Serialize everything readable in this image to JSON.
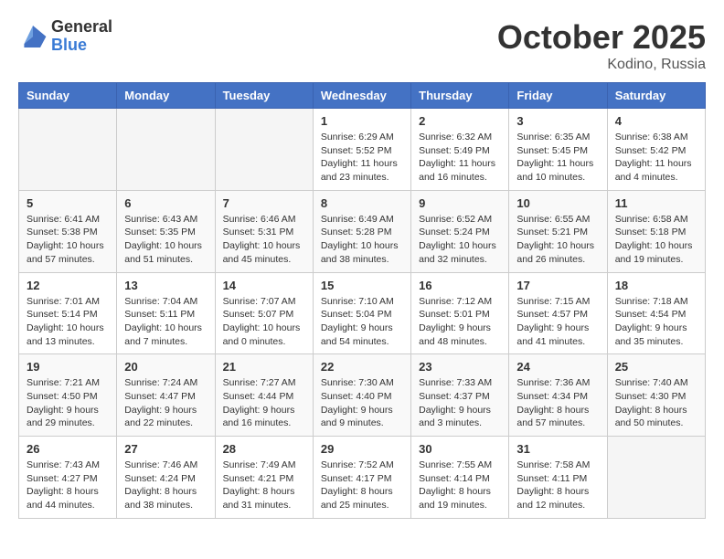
{
  "header": {
    "logo_general": "General",
    "logo_blue": "Blue",
    "month": "October 2025",
    "location": "Kodino, Russia"
  },
  "weekdays": [
    "Sunday",
    "Monday",
    "Tuesday",
    "Wednesday",
    "Thursday",
    "Friday",
    "Saturday"
  ],
  "weeks": [
    [
      {
        "day": "",
        "info": ""
      },
      {
        "day": "",
        "info": ""
      },
      {
        "day": "",
        "info": ""
      },
      {
        "day": "1",
        "info": "Sunrise: 6:29 AM\nSunset: 5:52 PM\nDaylight: 11 hours\nand 23 minutes."
      },
      {
        "day": "2",
        "info": "Sunrise: 6:32 AM\nSunset: 5:49 PM\nDaylight: 11 hours\nand 16 minutes."
      },
      {
        "day": "3",
        "info": "Sunrise: 6:35 AM\nSunset: 5:45 PM\nDaylight: 11 hours\nand 10 minutes."
      },
      {
        "day": "4",
        "info": "Sunrise: 6:38 AM\nSunset: 5:42 PM\nDaylight: 11 hours\nand 4 minutes."
      }
    ],
    [
      {
        "day": "5",
        "info": "Sunrise: 6:41 AM\nSunset: 5:38 PM\nDaylight: 10 hours\nand 57 minutes."
      },
      {
        "day": "6",
        "info": "Sunrise: 6:43 AM\nSunset: 5:35 PM\nDaylight: 10 hours\nand 51 minutes."
      },
      {
        "day": "7",
        "info": "Sunrise: 6:46 AM\nSunset: 5:31 PM\nDaylight: 10 hours\nand 45 minutes."
      },
      {
        "day": "8",
        "info": "Sunrise: 6:49 AM\nSunset: 5:28 PM\nDaylight: 10 hours\nand 38 minutes."
      },
      {
        "day": "9",
        "info": "Sunrise: 6:52 AM\nSunset: 5:24 PM\nDaylight: 10 hours\nand 32 minutes."
      },
      {
        "day": "10",
        "info": "Sunrise: 6:55 AM\nSunset: 5:21 PM\nDaylight: 10 hours\nand 26 minutes."
      },
      {
        "day": "11",
        "info": "Sunrise: 6:58 AM\nSunset: 5:18 PM\nDaylight: 10 hours\nand 19 minutes."
      }
    ],
    [
      {
        "day": "12",
        "info": "Sunrise: 7:01 AM\nSunset: 5:14 PM\nDaylight: 10 hours\nand 13 minutes."
      },
      {
        "day": "13",
        "info": "Sunrise: 7:04 AM\nSunset: 5:11 PM\nDaylight: 10 hours\nand 7 minutes."
      },
      {
        "day": "14",
        "info": "Sunrise: 7:07 AM\nSunset: 5:07 PM\nDaylight: 10 hours\nand 0 minutes."
      },
      {
        "day": "15",
        "info": "Sunrise: 7:10 AM\nSunset: 5:04 PM\nDaylight: 9 hours\nand 54 minutes."
      },
      {
        "day": "16",
        "info": "Sunrise: 7:12 AM\nSunset: 5:01 PM\nDaylight: 9 hours\nand 48 minutes."
      },
      {
        "day": "17",
        "info": "Sunrise: 7:15 AM\nSunset: 4:57 PM\nDaylight: 9 hours\nand 41 minutes."
      },
      {
        "day": "18",
        "info": "Sunrise: 7:18 AM\nSunset: 4:54 PM\nDaylight: 9 hours\nand 35 minutes."
      }
    ],
    [
      {
        "day": "19",
        "info": "Sunrise: 7:21 AM\nSunset: 4:50 PM\nDaylight: 9 hours\nand 29 minutes."
      },
      {
        "day": "20",
        "info": "Sunrise: 7:24 AM\nSunset: 4:47 PM\nDaylight: 9 hours\nand 22 minutes."
      },
      {
        "day": "21",
        "info": "Sunrise: 7:27 AM\nSunset: 4:44 PM\nDaylight: 9 hours\nand 16 minutes."
      },
      {
        "day": "22",
        "info": "Sunrise: 7:30 AM\nSunset: 4:40 PM\nDaylight: 9 hours\nand 9 minutes."
      },
      {
        "day": "23",
        "info": "Sunrise: 7:33 AM\nSunset: 4:37 PM\nDaylight: 9 hours\nand 3 minutes."
      },
      {
        "day": "24",
        "info": "Sunrise: 7:36 AM\nSunset: 4:34 PM\nDaylight: 8 hours\nand 57 minutes."
      },
      {
        "day": "25",
        "info": "Sunrise: 7:40 AM\nSunset: 4:30 PM\nDaylight: 8 hours\nand 50 minutes."
      }
    ],
    [
      {
        "day": "26",
        "info": "Sunrise: 7:43 AM\nSunset: 4:27 PM\nDaylight: 8 hours\nand 44 minutes."
      },
      {
        "day": "27",
        "info": "Sunrise: 7:46 AM\nSunset: 4:24 PM\nDaylight: 8 hours\nand 38 minutes."
      },
      {
        "day": "28",
        "info": "Sunrise: 7:49 AM\nSunset: 4:21 PM\nDaylight: 8 hours\nand 31 minutes."
      },
      {
        "day": "29",
        "info": "Sunrise: 7:52 AM\nSunset: 4:17 PM\nDaylight: 8 hours\nand 25 minutes."
      },
      {
        "day": "30",
        "info": "Sunrise: 7:55 AM\nSunset: 4:14 PM\nDaylight: 8 hours\nand 19 minutes."
      },
      {
        "day": "31",
        "info": "Sunrise: 7:58 AM\nSunset: 4:11 PM\nDaylight: 8 hours\nand 12 minutes."
      },
      {
        "day": "",
        "info": ""
      }
    ]
  ]
}
